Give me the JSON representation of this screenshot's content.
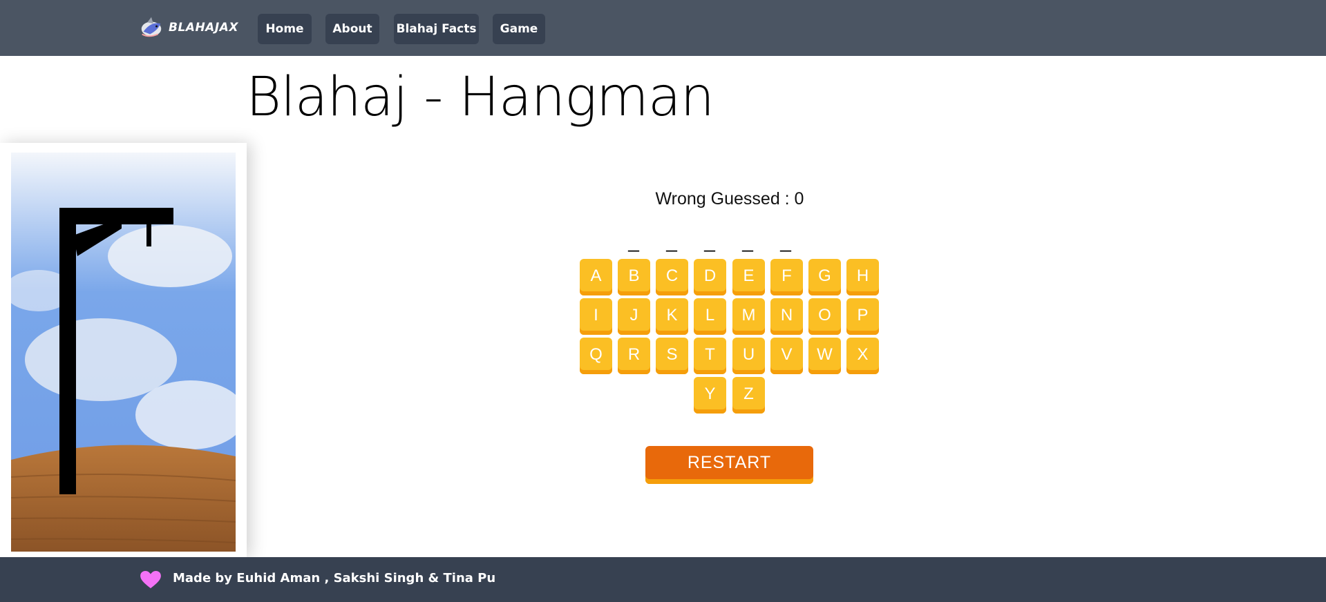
{
  "nav": {
    "brand": "BLAHAJAX",
    "items": [
      {
        "label": "Home"
      },
      {
        "label": "About"
      },
      {
        "label": "Blahaj Facts"
      },
      {
        "label": "Game"
      }
    ]
  },
  "page": {
    "title": "Blahaj - Hangman"
  },
  "game": {
    "wrong_label": "Wrong Guessed : 0",
    "word_blanks": [
      "_",
      "_",
      "_",
      "_",
      "_"
    ],
    "keys": [
      "A",
      "B",
      "C",
      "D",
      "E",
      "F",
      "G",
      "H",
      "I",
      "J",
      "K",
      "L",
      "M",
      "N",
      "O",
      "P",
      "Q",
      "R",
      "S",
      "T",
      "U",
      "V",
      "W",
      "X",
      "Y",
      "Z"
    ],
    "restart_label": "RESTART"
  },
  "footer": {
    "credit": "Made by Euhid Aman , Sakshi Singh & Tina Pu"
  },
  "colors": {
    "navbar": "#4b5563",
    "nav_button": "#374151",
    "footer": "#374151",
    "key": "#fbbf24",
    "key_shadow": "#f59e0b",
    "restart": "#e8690b",
    "heart": "#f472f6"
  },
  "icons": {
    "brand": "blahaj-shark-icon",
    "footer": "heart-icon"
  }
}
